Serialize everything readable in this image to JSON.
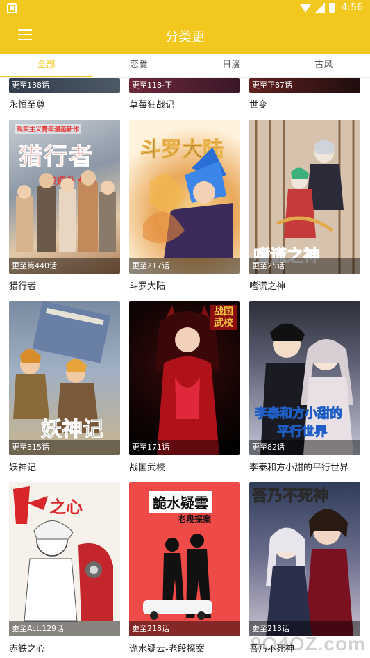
{
  "status_bar": {
    "time": "4:56"
  },
  "app_bar": {
    "title": "分类更"
  },
  "tabs": [
    {
      "label": "全部",
      "active": true
    },
    {
      "label": "恋爱",
      "active": false
    },
    {
      "label": "日漫",
      "active": false
    },
    {
      "label": "古风",
      "active": false
    }
  ],
  "rows": [
    [
      {
        "title": "永恒至尊",
        "update": "更至138话"
      },
      {
        "title": "草莓狂战记",
        "update": "更至118-下"
      },
      {
        "title": "世变",
        "update": "更至正87话"
      }
    ],
    [
      {
        "title": "猎行者",
        "update": "更至第440话",
        "cover_text": "猎行者",
        "cover_sub": "权迎升 作品",
        "cover_top": "现实主义青年漫画新作"
      },
      {
        "title": "斗罗大陆",
        "update": "更至217话",
        "cover_text": "斗罗大陆"
      },
      {
        "title": "嗜谎之神",
        "update": "更至25话",
        "cover_text": "嗜谎之神"
      }
    ],
    [
      {
        "title": "妖神记",
        "update": "更至315话",
        "cover_text": "妖神记"
      },
      {
        "title": "战国武校",
        "update": "更至171话",
        "cover_text": "战国武校"
      },
      {
        "title": "李泰和方小甜的平行世界",
        "update": "更至82话",
        "cover_text": "李泰和方小甜的",
        "cover_text2": "平行世界"
      }
    ],
    [
      {
        "title": "赤铁之心",
        "update": "更至Act.129话",
        "cover_text": "之心"
      },
      {
        "title": "诡水疑云-老段探案",
        "update": "更至218话",
        "cover_text": "詭水疑雲",
        "cover_sub": "老段探案"
      },
      {
        "title": "吾乃不死神",
        "update": "更至213话",
        "cover_text": "吾乃不死神"
      }
    ]
  ],
  "watermark": "9O4OZ.com"
}
